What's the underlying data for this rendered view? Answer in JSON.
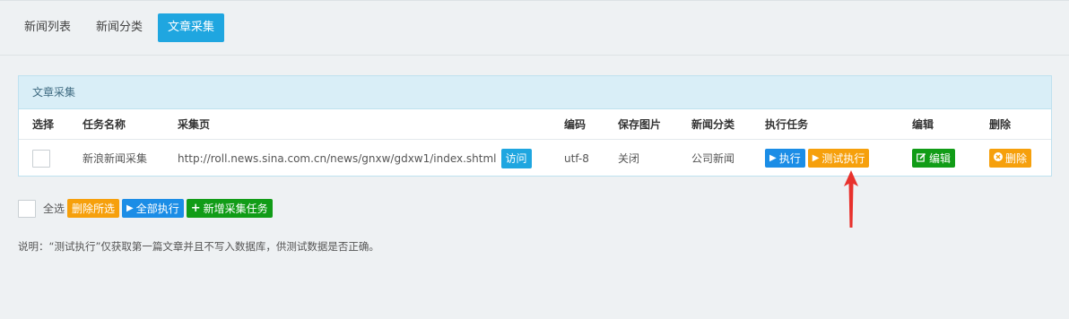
{
  "tabs": [
    {
      "label": "新闻列表",
      "active": false
    },
    {
      "label": "新闻分类",
      "active": false
    },
    {
      "label": "文章采集",
      "active": true
    }
  ],
  "panel": {
    "title": "文章采集",
    "columns": [
      "选择",
      "任务名称",
      "采集页",
      "编码",
      "保存图片",
      "新闻分类",
      "执行任务",
      "编辑",
      "删除"
    ],
    "row": {
      "task_name": "新浪新闻采集",
      "url": "http://roll.news.sina.com.cn/news/gnxw/gdxw1/index.shtml",
      "visit_label": "访问",
      "encoding": "utf-8",
      "save_images": "关闭",
      "category": "公司新闻",
      "execute_label": "执行",
      "test_execute_label": "测试执行",
      "edit_label": "编辑",
      "delete_label": "删除"
    }
  },
  "footer": {
    "select_all_label": "全选",
    "delete_selected_label": "删除所选",
    "execute_all_label": "全部执行",
    "add_task_label": "新增采集任务"
  },
  "note": "说明：“测试执行”仅获取第一篇文章并且不写入数据库，供测试数据是否正确。",
  "colors": {
    "accent": "#1fa6e0",
    "execute": "#1b8de6",
    "test_execute": "#f6a00c",
    "edit": "#119c17",
    "delete": "#f6a00c",
    "arrow": "#e8312c"
  },
  "icons": {
    "execute": "play-icon",
    "test_execute": "play-icon",
    "edit": "edit-icon",
    "delete": "times-circle-icon",
    "add_task": "plus-icon"
  }
}
